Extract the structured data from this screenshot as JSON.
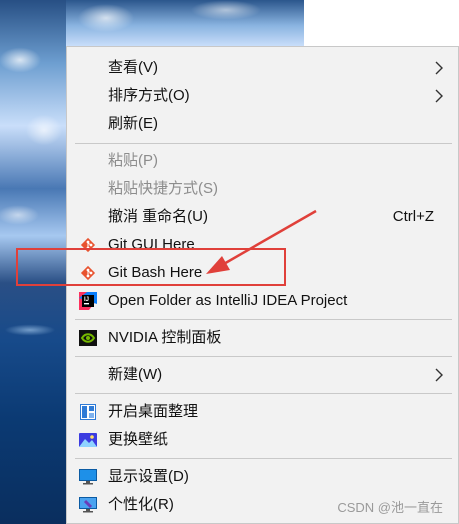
{
  "menu": {
    "items": [
      {
        "label": "查看(V)"
      },
      {
        "label": "排序方式(O)"
      },
      {
        "label": "刷新(E)"
      },
      {
        "label": "粘贴(P)"
      },
      {
        "label": "粘贴快捷方式(S)"
      },
      {
        "label": "撤消 重命名(U)",
        "shortcut": "Ctrl+Z"
      },
      {
        "label": "Git GUI Here",
        "icon": "git-icon"
      },
      {
        "label": "Git Bash Here",
        "icon": "git-icon"
      },
      {
        "label": "Open Folder as IntelliJ IDEA Project",
        "icon": "intellij-icon"
      },
      {
        "label": "NVIDIA 控制面板",
        "icon": "nvidia-icon"
      },
      {
        "label": "新建(W)"
      },
      {
        "label": "开启桌面整理",
        "icon": "desktop-organize-icon"
      },
      {
        "label": "更换壁纸",
        "icon": "wallpaper-icon"
      },
      {
        "label": "显示设置(D)",
        "icon": "display-icon"
      },
      {
        "label": "个性化(R)",
        "icon": "personalize-icon"
      }
    ]
  },
  "annotation": {
    "color": "#e0403a"
  },
  "watermark": "CSDN @池一直在"
}
